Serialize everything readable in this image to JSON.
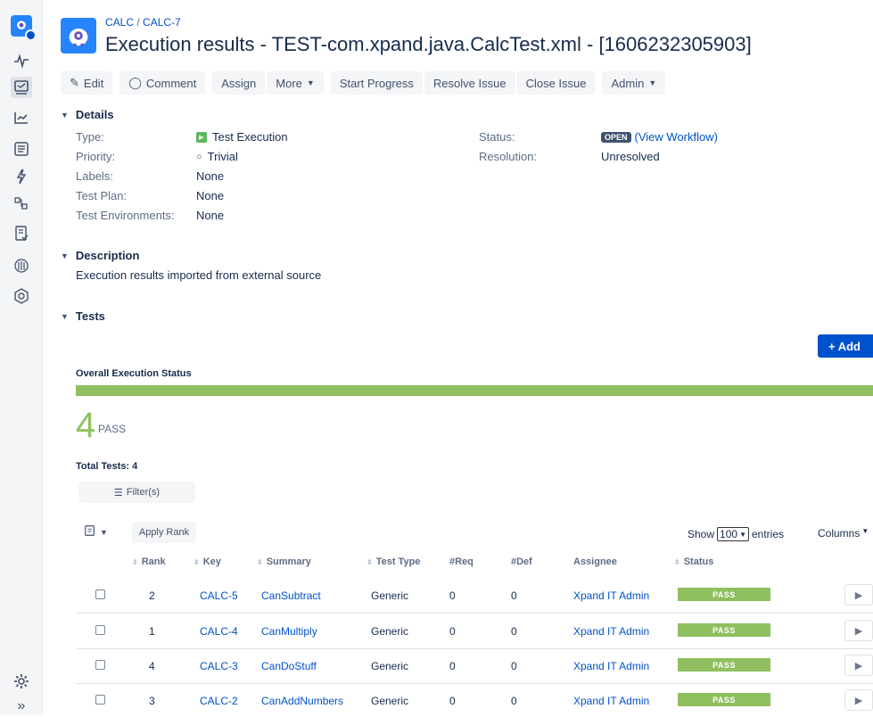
{
  "breadcrumb": {
    "project": "CALC",
    "separator": "/",
    "issue": "CALC-7"
  },
  "title": "Execution results - TEST-com.xpand.java.CalcTest.xml - [1606232305903]",
  "toolbar": {
    "edit": "Edit",
    "comment": "Comment",
    "assign": "Assign",
    "more": "More",
    "start_progress": "Start Progress",
    "resolve": "Resolve Issue",
    "close": "Close Issue",
    "admin": "Admin"
  },
  "details": {
    "heading": "Details",
    "type_label": "Type:",
    "type_value": "Test Execution",
    "priority_label": "Priority:",
    "priority_value": "Trivial",
    "labels_label": "Labels:",
    "labels_value": "None",
    "plan_label": "Test Plan:",
    "plan_value": "None",
    "env_label": "Test Environments:",
    "env_value": "None",
    "status_label": "Status:",
    "status_value": "OPEN",
    "workflow_open": "(",
    "workflow_link": "View Workflow",
    "workflow_close": ")",
    "resolution_label": "Resolution:",
    "resolution_value": "Unresolved"
  },
  "description": {
    "heading": "Description",
    "text": "Execution results imported from external source"
  },
  "tests": {
    "heading": "Tests",
    "add_button": "+ Add",
    "overall_label": "Overall Execution Status",
    "pass_count": "4",
    "pass_label": "PASS",
    "pass_fraction": 1.0,
    "total_label": "Total Tests: 4",
    "filter_button": "Filter(s)",
    "apply_rank": "Apply Rank",
    "show_label": "Show",
    "entries_value": "100",
    "entries_label": "entries",
    "columns_label": "Columns",
    "headers": {
      "rank": "Rank",
      "key": "Key",
      "summary": "Summary",
      "type": "Test Type",
      "req": "#Req",
      "def": "#Def",
      "assignee": "Assignee",
      "status": "Status"
    },
    "rows": [
      {
        "rank": "2",
        "key": "CALC-5",
        "summary": "CanSubtract",
        "type": "Generic",
        "req": "0",
        "def": "0",
        "assignee": "Xpand IT Admin",
        "status": "PASS"
      },
      {
        "rank": "1",
        "key": "CALC-4",
        "summary": "CanMultiply",
        "type": "Generic",
        "req": "0",
        "def": "0",
        "assignee": "Xpand IT Admin",
        "status": "PASS"
      },
      {
        "rank": "4",
        "key": "CALC-3",
        "summary": "CanDoStuff",
        "type": "Generic",
        "req": "0",
        "def": "0",
        "assignee": "Xpand IT Admin",
        "status": "PASS"
      },
      {
        "rank": "3",
        "key": "CALC-2",
        "summary": "CanAddNumbers",
        "type": "Generic",
        "req": "0",
        "def": "0",
        "assignee": "Xpand IT Admin",
        "status": "PASS"
      }
    ]
  },
  "colors": {
    "accent": "#0052cc",
    "pass": "#8fbf5e",
    "open": "#42526e"
  }
}
